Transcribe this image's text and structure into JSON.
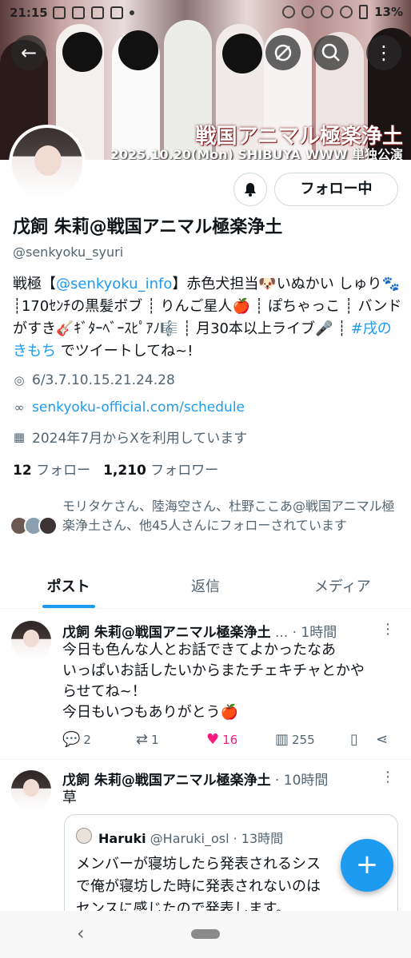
{
  "status_bar": {
    "time": "21:15",
    "battery": "13%"
  },
  "banner": {
    "event_title": "戦国アニマル極楽浄土",
    "event_date": "2025.10.20(Mon) SHIBUYA WWW 単独公演"
  },
  "header_icons": {
    "back": "←",
    "search": "⌕",
    "more": "⋮"
  },
  "profile": {
    "follow_button": "フォロー中",
    "name": "戊飼 朱莉@戦国アニマル極楽浄土",
    "handle": "@senkyoku_syuri",
    "bio_prefix": "戦極【",
    "bio_link": "@senkyoku_info",
    "bio_middle": "】赤色犬担当🐶いぬかい しゅり🐾 ┊170ｾﾝﾁの黒髪ボブ ┊ りんご星人🍎 ┊ ぽちゃっこ ┊ バンドがすき🎸ｷﾞﾀｰﾍﾞｰｽﾋﾟｱﾉ🎼 ┊ 月30本以上ライブ🎤 ┊ ",
    "bio_hashtag": "#戌のきもち",
    "bio_suffix": " でツイートしてね~!",
    "location": "6/3.7.10.15.21.24.28",
    "website": "senkyoku-official.com/schedule",
    "joined": "2024年7月からXを利用しています",
    "following_count": "12",
    "following_label": "フォロー",
    "followers_count": "1,210",
    "followers_label": "フォロワー",
    "followed_by": "モリタケさん、陸海空さん、杜野ここあ@戦国アニマル極楽浄土さん、他45人さんにフォローされています"
  },
  "tabs": [
    {
      "label": "ポスト",
      "active": true
    },
    {
      "label": "返信",
      "active": false
    },
    {
      "label": "メディア",
      "active": false
    }
  ],
  "tweets": [
    {
      "name": "戊飼 朱莉@戦国アニマル極楽浄土",
      "ellipsis": " ...",
      "time": " · 1時間",
      "text_lines": [
        "今日も色んな人とお話できてよかったなあ",
        "いっぱいお話したいからまたチェキチャとかや",
        "らせてね~！",
        "今日もいつもありがとう🍎"
      ],
      "replies": "2",
      "reposts": "1",
      "likes": "16",
      "views": "255"
    },
    {
      "name": "戊飼 朱莉@戦国アニマル極楽浄土",
      "time": " · 10時間",
      "text": "草",
      "quote": {
        "name": "Haruki",
        "handle": " @Haruki_osl",
        "time": " · 13時間",
        "lines": [
          "メンバーが寝坊したら発表されるシス",
          "で俺が寝坊した時に発表されないのは",
          "センスに感じたので発表します。"
        ]
      }
    }
  ],
  "fab_label": "+",
  "colors": {
    "accent": "#1d9bf0",
    "like": "#f91880",
    "muted": "#536471"
  }
}
